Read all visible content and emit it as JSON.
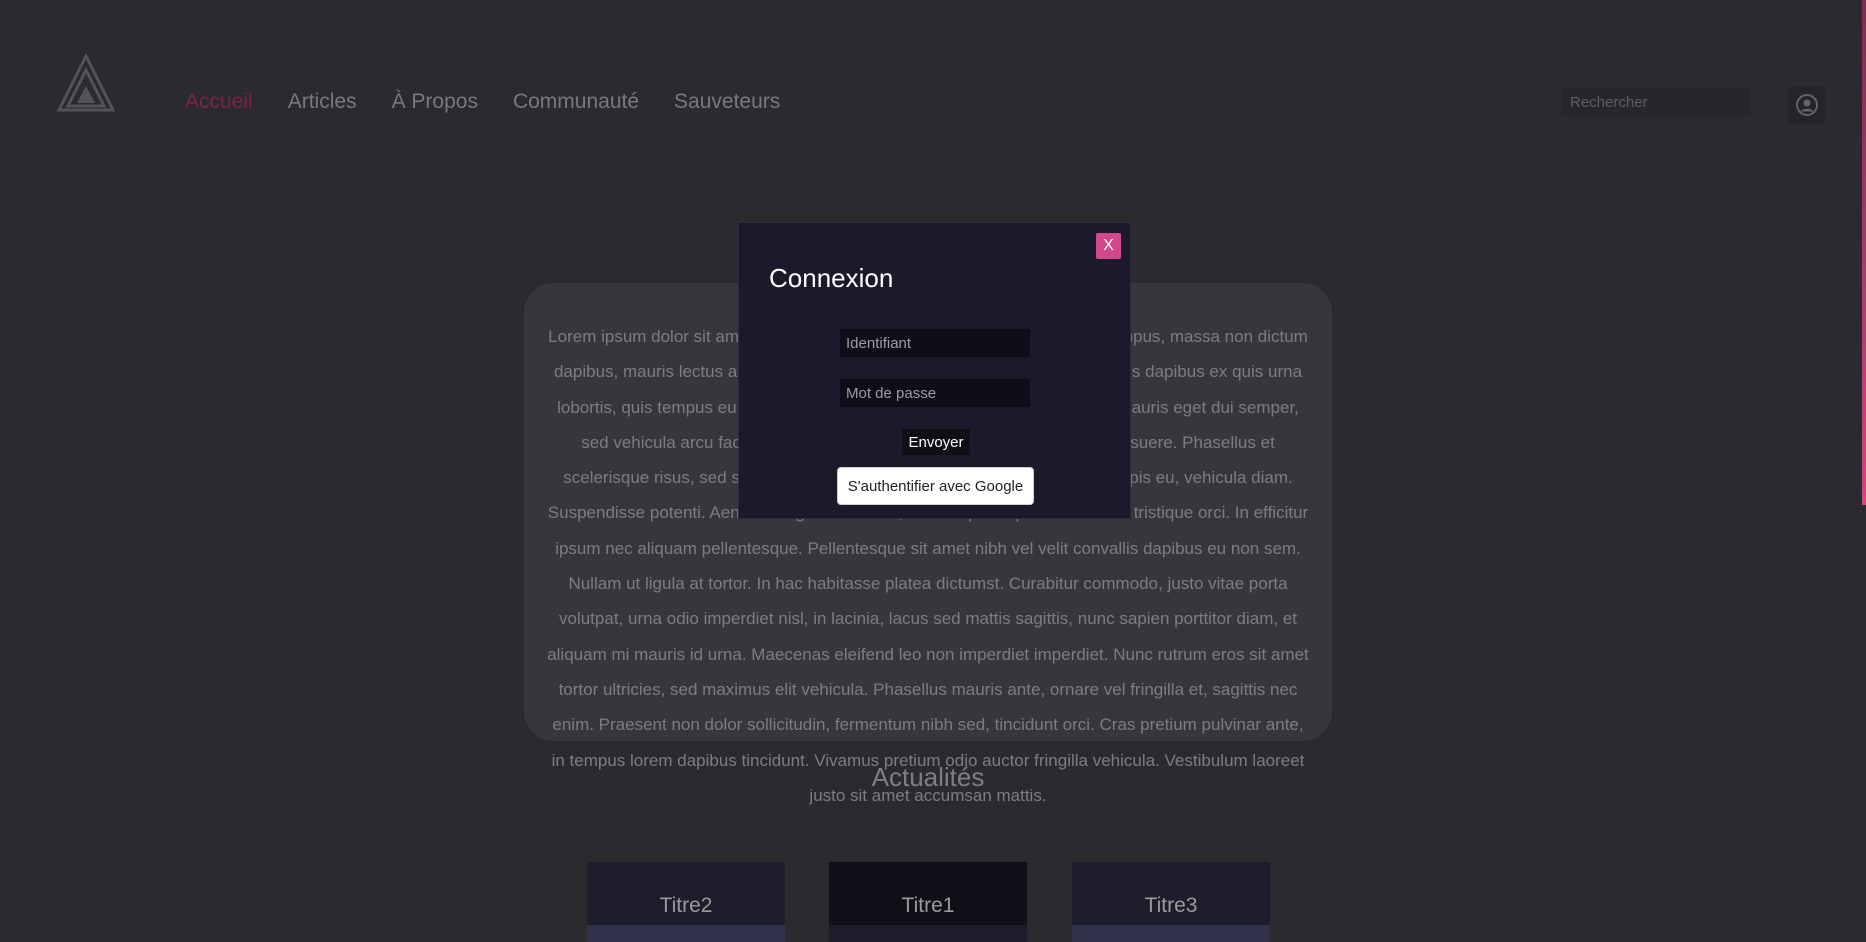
{
  "header": {
    "logo_icon": "triangle-logo-icon",
    "nav": [
      {
        "label": "Accueil",
        "active": true
      },
      {
        "label": "Articles",
        "active": false
      },
      {
        "label": "À Propos",
        "active": false
      },
      {
        "label": "Communauté",
        "active": false
      },
      {
        "label": "Sauveteurs",
        "active": false
      }
    ],
    "search_placeholder": "Rechercher",
    "user_icon": "user-circle-icon"
  },
  "main": {
    "intro_text": "Lorem ipsum dolor sit amet, consectetur adipiscing elit. Nulla facilisi. Duis tempus, massa non dictum dapibus, mauris lectus aliquet nunc, vitae luctus mauris mi sed enim. Vivamus dapibus ex quis urna lobortis, quis tempus eu congue at, consequat sed enim. Quisque ultricies mauris eget dui semper, sed vehicula arcu facilisis. Donec consequat nisl varius quam eleifend posuere. Phasellus et scelerisque risus, sed sodales magna. Vestibulum faucibus, consectetur turpis eu, vehicula diam. Suspendisse potenti. Aenean ac gravida lorem, sed tempor sapien. Nunc nec tristique orci. In efficitur ipsum nec aliquam pellentesque. Pellentesque sit amet nibh vel velit convallis dapibus eu non sem. Nullam ut ligula at tortor. In hac habitasse platea dictumst. Curabitur commodo, justo vitae porta volutpat, urna odio imperdiet nisl, in lacinia, lacus sed mattis sagittis, nunc sapien porttitor diam, et aliquam mi mauris id urna. Maecenas eleifend leo non imperdiet imperdiet. Nunc rutrum eros sit amet tortor ultricies, sed maximus elit vehicula. Phasellus mauris ante, ornare vel fringilla et, sagittis nec enim. Praesent non dolor sollicitudin, fermentum nibh sed, tincidunt orci. Cras pretium pulvinar ante, in tempus lorem dapibus tincidunt. Vivamus pretium odio auctor fringilla vehicula. Vestibulum laoreet justo sit amet accumsan mattis.",
    "news_title": "Actualités",
    "news_cards": [
      {
        "title": "Titre2"
      },
      {
        "title": "Titre1"
      },
      {
        "title": "Titre3"
      }
    ]
  },
  "modal": {
    "close_label": "X",
    "title": "Connexion",
    "username_placeholder": "Identifiant",
    "password_placeholder": "Mot de passe",
    "submit_label": "Envoyer",
    "google_label": "S'authentifier avec Google"
  },
  "colors": {
    "accent": "#d2488a",
    "active_nav": "#d13b77",
    "modal_bg": "#1b1a2a"
  }
}
